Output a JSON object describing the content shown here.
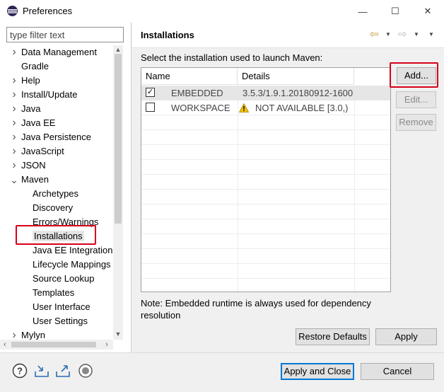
{
  "window": {
    "title": "Preferences",
    "minimize_glyph": "—",
    "maximize_glyph": "☐",
    "close_glyph": "✕"
  },
  "filter": {
    "placeholder": "type filter text"
  },
  "tree": {
    "items": [
      {
        "label": "Data Management",
        "arrow": "›"
      },
      {
        "label": "Gradle",
        "arrow": ""
      },
      {
        "label": "Help",
        "arrow": "›"
      },
      {
        "label": "Install/Update",
        "arrow": "›"
      },
      {
        "label": "Java",
        "arrow": "›"
      },
      {
        "label": "Java EE",
        "arrow": "›"
      },
      {
        "label": "Java Persistence",
        "arrow": "›"
      },
      {
        "label": "JavaScript",
        "arrow": "›"
      },
      {
        "label": "JSON",
        "arrow": "›"
      },
      {
        "label": "Maven",
        "arrow": "⌄"
      },
      {
        "label": "Archetypes",
        "arrow": ""
      },
      {
        "label": "Discovery",
        "arrow": ""
      },
      {
        "label": "Errors/Warnings",
        "arrow": ""
      },
      {
        "label": "Installations",
        "arrow": ""
      },
      {
        "label": "Java EE Integration",
        "arrow": ""
      },
      {
        "label": "Lifecycle Mappings",
        "arrow": ""
      },
      {
        "label": "Source Lookup",
        "arrow": ""
      },
      {
        "label": "Templates",
        "arrow": ""
      },
      {
        "label": "User Interface",
        "arrow": ""
      },
      {
        "label": "User Settings",
        "arrow": ""
      },
      {
        "label": "Mylyn",
        "arrow": "›"
      }
    ],
    "selected": "Installations"
  },
  "page": {
    "title": "Installations",
    "description": "Select the installation used to launch Maven:",
    "note": "Note: Embedded runtime is always used for dependency resolution"
  },
  "table": {
    "columns": [
      "Name",
      "Details"
    ],
    "rows": [
      {
        "checked": true,
        "check_glyph": "✓",
        "name": "EMBEDDED",
        "details": "3.5.3/1.9.1.20180912-1600",
        "warning": false
      },
      {
        "checked": false,
        "check_glyph": "",
        "name": "WORKSPACE",
        "details": "NOT AVAILABLE [3.0,)",
        "warning": true
      }
    ]
  },
  "buttons": {
    "add": "Add...",
    "edit": "Edit...",
    "remove": "Remove",
    "restore_defaults": "Restore Defaults",
    "apply": "Apply",
    "apply_and_close": "Apply and Close",
    "cancel": "Cancel"
  },
  "icons": {
    "back": "⇦",
    "forward": "⇨",
    "dropdown": "▼",
    "help": "help-icon",
    "import": "import-icon",
    "export": "export-icon",
    "record": "record-icon"
  },
  "colors": {
    "highlight": "#d7001c",
    "default_button_border": "#0078d7"
  }
}
